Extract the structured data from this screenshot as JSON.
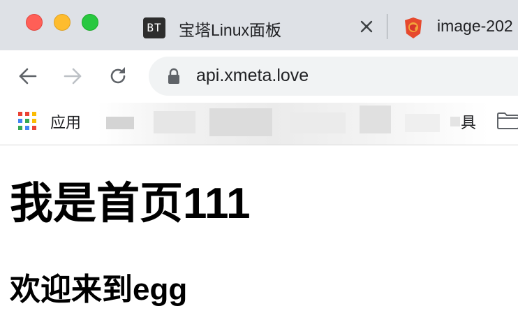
{
  "browser": {
    "tabs": [
      {
        "icon": "bt-icon",
        "icon_text": "BT",
        "title": "宝塔Linux面板",
        "active": true
      },
      {
        "icon": "shield-icon",
        "title": "image-202",
        "active": false
      }
    ],
    "address_bar": {
      "url": "api.xmeta.love"
    },
    "bookmarks": {
      "apps_label": "应用",
      "partial_item_text": "具"
    }
  },
  "page": {
    "heading1": "我是首页111",
    "heading2": "欢迎来到egg"
  },
  "colors": {
    "tabstrip_bg": "#dee1e6",
    "close_red": "#ff5f57",
    "minimize_yellow": "#febc2e",
    "zoom_green": "#28c840",
    "omnibox_bg": "#f1f3f4"
  }
}
